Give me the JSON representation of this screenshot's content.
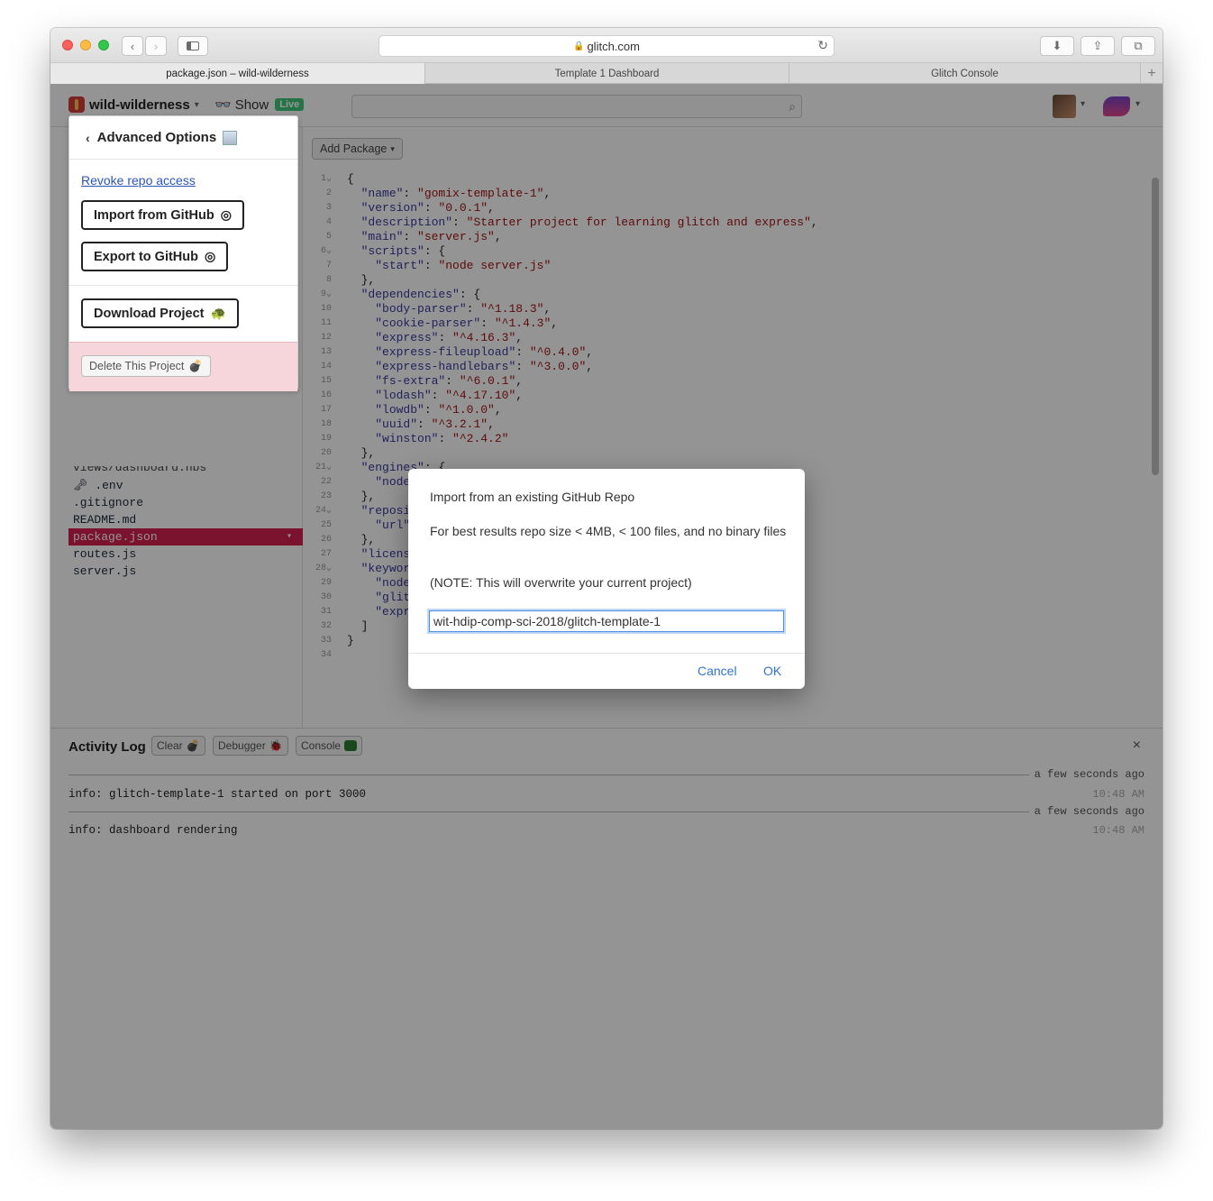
{
  "browser": {
    "url": "glitch.com",
    "tabs": [
      "package.json – wild-wilderness",
      "Template 1 Dashboard",
      "Glitch Console"
    ],
    "new_tab": "+"
  },
  "header": {
    "project_name": "wild-wilderness",
    "show_label": "Show",
    "live_badge": "Live"
  },
  "advanced": {
    "title": "Advanced Options",
    "revoke": "Revoke repo access",
    "import": "Import from GitHub",
    "export": "Export to GitHub",
    "download": "Download Project",
    "delete": "Delete This Project"
  },
  "files": {
    "partial_top": "views/dashboard.hbs",
    "items": [
      ".env",
      ".gitignore",
      "README.md",
      "package.json",
      "routes.js",
      "server.js"
    ]
  },
  "editor": {
    "add_package": "Add Package",
    "lines": [
      "{",
      "  \"name\": \"gomix-template-1\",",
      "  \"version\": \"0.0.1\",",
      "  \"description\": \"Starter project for learning glitch and express\",",
      "  \"main\": \"server.js\",",
      "  \"scripts\": {",
      "    \"start\": \"node server.js\"",
      "  },",
      "  \"dependencies\": {",
      "    \"body-parser\": \"^1.18.3\",",
      "    \"cookie-parser\": \"^1.4.3\",",
      "    \"express\": \"^4.16.3\",",
      "    \"express-fileupload\": \"^0.4.0\",",
      "    \"express-handlebars\": \"^3.0.0\",",
      "    \"fs-extra\": \"^6.0.1\",",
      "    \"lodash\": \"^4.17.10\",",
      "    \"lowdb\": \"^1.0.0\",",
      "    \"uuid\": \"^3.2.1\",",
      "    \"winston\": \"^2.4.2\"",
      "  },",
      "  \"engines\": {",
      "    \"node\"",
      "  },",
      "  \"repository\": {",
      "    \"url\"                                                 late-1\"",
      "  },",
      "  \"license\"",
      "  \"keywords\": [",
      "    \"node\"",
      "    \"glitch\"",
      "    \"express\"",
      "  ]",
      "}",
      ""
    ]
  },
  "activity": {
    "title": "Activity Log",
    "clear": "Clear",
    "debugger": "Debugger",
    "console": "Console",
    "close": "×",
    "entries": [
      {
        "relative": "a few seconds ago",
        "text": "info: glitch-template-1 started on port 3000",
        "time": "10:48 AM"
      },
      {
        "relative": "a few seconds ago",
        "text": "info: dashboard rendering",
        "time": "10:48 AM"
      }
    ]
  },
  "dialog": {
    "heading": "Import from an existing GitHub Repo",
    "hint": " For best results repo size < 4MB, < 100 files, and no binary files",
    "note": " (NOTE: This will overwrite your current project)",
    "input_value": "wit-hdip-comp-sci-2018/glitch-template-1",
    "cancel": "Cancel",
    "ok": "OK"
  }
}
